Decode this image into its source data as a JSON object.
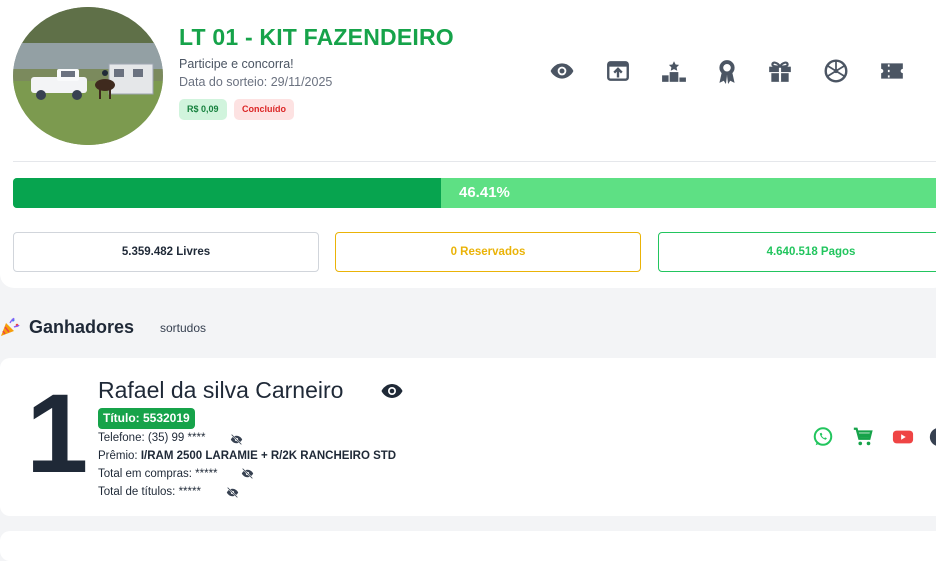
{
  "raffle": {
    "title": "LT 01 - KIT FAZENDEIRO",
    "subtitle": "Participe e concorra!",
    "draw_date": "Data do sorteio: 29/11/2025",
    "price_badge": "R$ 0,09",
    "status_badge": "Concluído"
  },
  "actions": [
    {
      "icon": "eye-icon"
    },
    {
      "icon": "share-icon"
    },
    {
      "icon": "podium-icon"
    },
    {
      "icon": "award-icon"
    },
    {
      "icon": "gift-icon"
    },
    {
      "icon": "wheel-icon"
    },
    {
      "icon": "ticket-icon"
    }
  ],
  "progress": {
    "percent": 46.41,
    "label": "46.41%"
  },
  "stats": {
    "free": "5.359.482 Livres",
    "reserved": "0 Reservados",
    "paid": "4.640.518 Pagos"
  },
  "winners_section": {
    "title": "Ganhadores",
    "subtitle": "sortudos"
  },
  "winner": {
    "rank": "1",
    "name": "Rafael da silva Carneiro",
    "ticket": "Título: 5532019",
    "phone_label": "Telefone:",
    "phone_value": "(35) 99 ****",
    "prize_label": "Prêmio:",
    "prize_value": "I/RAM 2500 LARAMIE + R/2K RANCHEIRO STD",
    "total_purchases_label": "Total em compras:",
    "total_purchases_value": "*****",
    "total_titles_label": "Total de títulos:",
    "total_titles_value": "*****"
  },
  "colors": {
    "brand_green": "#16a34a",
    "progress_fill": "#07a44f",
    "progress_track": "#5ee084",
    "reserved": "#eab308",
    "paid": "#22c55e",
    "whatsapp": "#22c55e",
    "youtube": "#ef4444"
  }
}
